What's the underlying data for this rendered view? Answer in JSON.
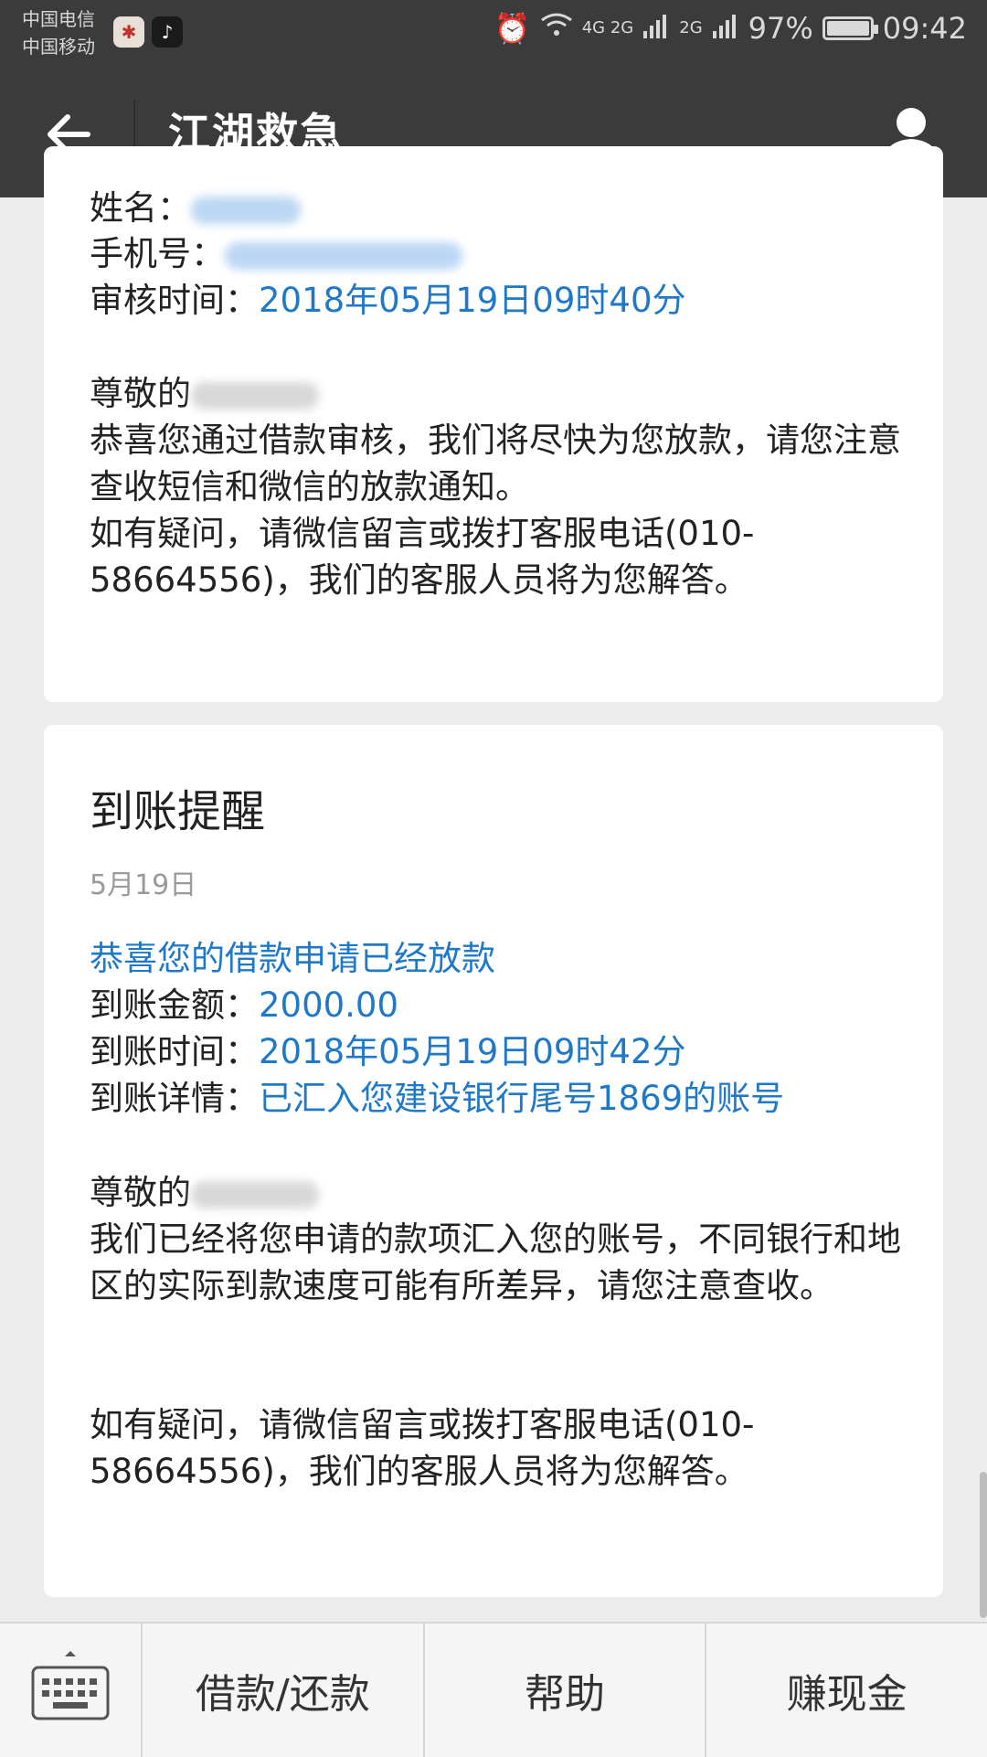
{
  "status_bar": {
    "carrier_1": "中国电信",
    "carrier_2": "中国移动",
    "network_1": "4G 2G",
    "network_2": "2G",
    "battery": "97%",
    "time": "09:42"
  },
  "header": {
    "title": "江湖救急"
  },
  "card1": {
    "name_label": "姓名：",
    "phone_label": "手机号：",
    "review_label": "审核时间：",
    "review_time": "2018年05月19日09时40分",
    "greeting": "尊敬的",
    "body_1": "恭喜您通过借款审核，我们将尽快为您放款，请您注意查收短信和微信的放款通知。",
    "body_2": "如有疑问，请微信留言或拨打客服电话(010-58664556)，我们的客服人员将为您解答。"
  },
  "card2": {
    "title": "到账提醒",
    "date": "5月19日",
    "headline": "恭喜您的借款申请已经放款",
    "amount_label": "到账金额：",
    "amount": "2000.00",
    "time_label": "到账时间：",
    "time": "2018年05月19日09时42分",
    "detail_label": "到账详情：",
    "detail": "已汇入您建设银行尾号1869的账号",
    "greeting": "尊敬的",
    "body_1": "我们已经将您申请的款项汇入您的账号，不同银行和地区的实际到款速度可能有所差异，请您注意查收。",
    "body_2": "如有疑问，请微信留言或拨打客服电话(010-58664556)，我们的客服人员将为您解答。"
  },
  "bottom_menu": {
    "items": [
      "借款/还款",
      "帮助",
      "赚现金"
    ]
  },
  "colors": {
    "bar_bg": "#3b3b3b",
    "link_blue": "#1f78c8",
    "page_bg": "#ececec"
  }
}
